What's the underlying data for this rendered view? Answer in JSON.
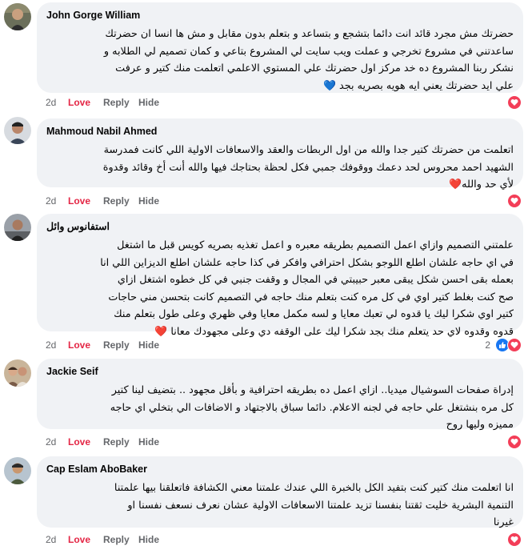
{
  "comments": [
    {
      "author": "John Gorge William",
      "lines": [
        "حضرتك مش مجرد قائد انت دائما بتشجع و بتساعد و بتعلم بدون مقابل و مش ها انسا ان حضرتك",
        "ساعدتني في مشروع تخرجي و عملت ويب سايت لي المشروع بتاعي و كمان تصميم لي الطلابه و",
        "نشكر ربنا المشروع ده خد مركز اول حضرتك علي المستوي الاعلمي اتعلمت منك كتير و عرفت",
        "علي ايد حضرتك يعني ايه هويه بصريه بجد 💙"
      ],
      "time": "2d",
      "love": "Love",
      "reply": "Reply",
      "hide": "Hide",
      "reaction": "heart",
      "reaction_count": ""
    },
    {
      "author": "Mahmoud Nabil Ahmed",
      "lines": [
        "اتعلمت من حضرتك كتير جدا والله من اول الربطات والعقد والاسعافات الاولية اللي كانت فمدرسة",
        "الشهيد احمد محروس لحد دعمك ووقوفك جمبي فكل لحظة بحتاجك فيها والله أنت أخ وقائد وقدوة",
        "لأي حد والله❤️"
      ],
      "time": "2d",
      "love": "Love",
      "reply": "Reply",
      "hide": "Hide",
      "reaction": "heart",
      "reaction_count": ""
    },
    {
      "author": "استفانوس وائل",
      "lines": [
        "علمتني التصميم وازاي اعمل التصميم بطريقه معبره و اعمل تغذيه بصريه كويس قبل ما اشتغل",
        "في اي حاجه علشان اطلع اللوجو بشكل احترافي وافكر في كذا حاجه علشان اطلع الديزاين اللي انا",
        "بعمله بقى احسن شكل يبقى معبر حبيبتي في المجال و وقفت جنبي في كل خطوه اشتغل ازاي",
        "صح كنت بغلط كتير اوي في كل مره كنت بتعلم منك حاجه في التصميم كانت بتحسن مني حاجات",
        "كتير اوي شكرا ليك يا قدوه لي تعبك معايا و لسه مكمل معايا وفي ظهري وعلى طول بتعلم منك",
        "قدوه وقدوه لاي حد يتعلم منك بجد شكرا ليك على الوقفه دي وعلى مجهودك معانا ❤️"
      ],
      "time": "2d",
      "love": "Love",
      "reply": "Reply",
      "hide": "Hide",
      "reaction": "like-heart",
      "reaction_count": "2"
    },
    {
      "author": "Jackie Seif",
      "lines": [
        "إدراة صفحات السوشيال ميديا.. ازاي اعمل ده بطريقه احترافية و بأقل مجهود .. بتضيف لينا كتير",
        "كل مره بنشتغل علي حاجه في لجنه الاعلام. دائما سباق بالاجتهاد و الاضافات الي بتخلي اي حاجه",
        "مميزه وليها روح"
      ],
      "time": "2d",
      "love": "Love",
      "reply": "Reply",
      "hide": "Hide",
      "reaction": "heart",
      "reaction_count": ""
    },
    {
      "author": "Cap Eslam AboBaker",
      "lines": [
        "انا اتعلمت منك كتير كنت بتفيد الكل بالخبرة اللي عندك علمتنا معني الكشافة فاتعلقنا بيها علمتنا",
        "التنمية البشرية خليت ثقتنا بنفسنا تزيد علمتنا الاسعافات الاولية عشان نعرف نسعف نفسنا او",
        "غيرنا"
      ],
      "time": "2d",
      "love": "Love",
      "reply": "Reply",
      "hide": "Hide",
      "reaction": "heart",
      "reaction_count": ""
    }
  ],
  "colors": {
    "bubble": "#f0f2f5",
    "love": "#e42645",
    "heart_badge": "#f33e58",
    "like_badge": "#1877f2"
  }
}
